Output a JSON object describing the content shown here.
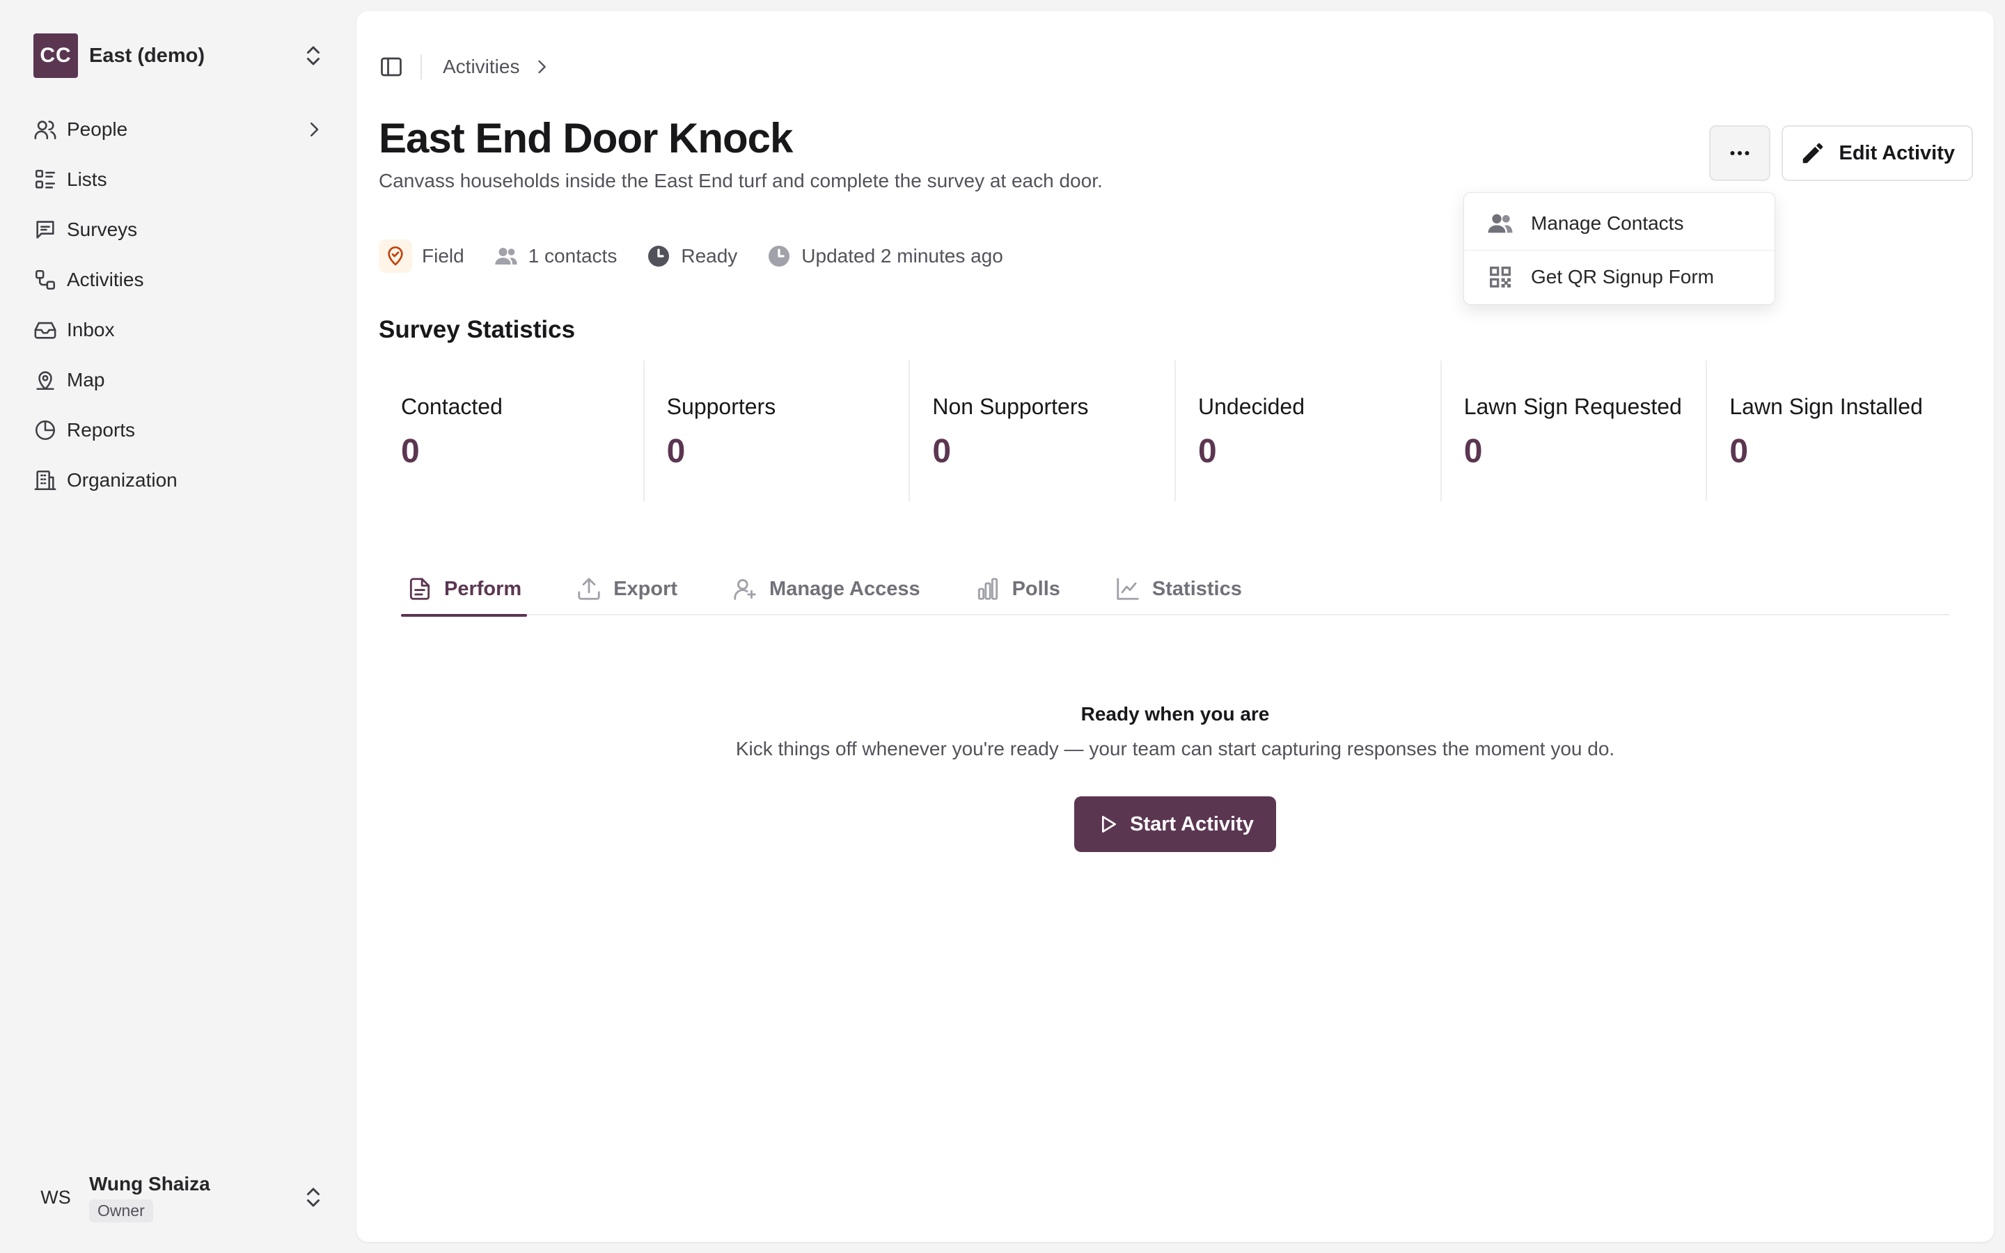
{
  "sidebar": {
    "org_initials": "CC",
    "org_name": "East (demo)",
    "items": [
      {
        "label": "People",
        "icon": "users-icon"
      },
      {
        "label": "Lists",
        "icon": "list-icon"
      },
      {
        "label": "Surveys",
        "icon": "message-icon"
      },
      {
        "label": "Activities",
        "icon": "activity-icon"
      },
      {
        "label": "Inbox",
        "icon": "inbox-icon"
      },
      {
        "label": "Map",
        "icon": "map-pin-icon"
      },
      {
        "label": "Reports",
        "icon": "pie-chart-icon"
      },
      {
        "label": "Organization",
        "icon": "building-icon"
      }
    ],
    "user": {
      "initials": "WS",
      "name": "Wung Shaiza",
      "role": "Owner"
    }
  },
  "breadcrumb": {
    "items": [
      "Activities"
    ]
  },
  "page": {
    "title": "East End Door Knock",
    "description": "Canvass households inside the East End turf and complete the survey at each door."
  },
  "actions": {
    "edit_label": "Edit Activity"
  },
  "dropdown": {
    "items": [
      {
        "label": "Manage Contacts",
        "icon": "users-icon"
      },
      {
        "label": "Get QR Signup Form",
        "icon": "qr-code-icon"
      }
    ]
  },
  "meta": {
    "type": "Field",
    "contacts": "1 contacts",
    "status": "Ready",
    "updated": "Updated 2 minutes ago"
  },
  "survey_statistics": {
    "title": "Survey Statistics",
    "stats": [
      {
        "label": "Contacted",
        "value": "0"
      },
      {
        "label": "Supporters",
        "value": "0"
      },
      {
        "label": "Non Supporters",
        "value": "0"
      },
      {
        "label": "Undecided",
        "value": "0"
      },
      {
        "label": "Lawn Sign Requested",
        "value": "0"
      },
      {
        "label": "Lawn Sign Installed",
        "value": "0"
      }
    ]
  },
  "tabs": [
    {
      "label": "Perform",
      "active": true
    },
    {
      "label": "Export",
      "active": false
    },
    {
      "label": "Manage Access",
      "active": false
    },
    {
      "label": "Polls",
      "active": false
    },
    {
      "label": "Statistics",
      "active": false
    }
  ],
  "empty_state": {
    "title": "Ready when you are",
    "description": "Kick things off whenever you're ready — your team can start capturing responses the moment you do.",
    "button_label": "Start Activity"
  },
  "colors": {
    "accent": "#5b3651",
    "field_icon": "#c2410c",
    "muted_text": "#52525b"
  }
}
